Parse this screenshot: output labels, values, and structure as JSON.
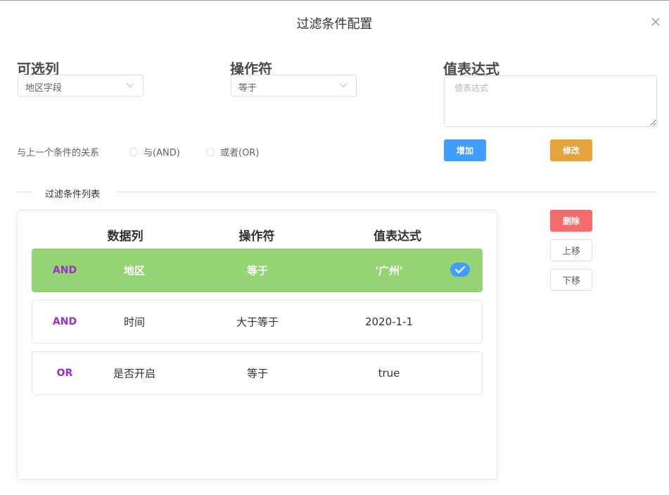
{
  "dialog": {
    "title": "过滤条件配置"
  },
  "form": {
    "column_label": "可选列",
    "column_value": "地区字段",
    "operator_label": "操作符",
    "operator_value": "等于",
    "expression_label": "值表达式",
    "expression_placeholder": "值表达式",
    "relation_label": "与上一个条件的关系",
    "relation_options": [
      "与(AND)",
      "或者(OR)"
    ],
    "add_button": "增加",
    "modify_button": "修改"
  },
  "divider": {
    "title": "过滤条件列表"
  },
  "list": {
    "headers": [
      "数据列",
      "操作符",
      "值表达式"
    ],
    "rows": [
      {
        "relation": "AND",
        "column": "地区",
        "operator": "等于",
        "value": "'广州'",
        "selected": true
      },
      {
        "relation": "AND",
        "column": "时间",
        "operator": "大于等于",
        "value": "2020-1-1",
        "selected": false
      },
      {
        "relation": "OR",
        "column": "是否开启",
        "operator": "等于",
        "value": "true",
        "selected": false
      }
    ]
  },
  "actions": {
    "delete": "删除",
    "move_up": "上移",
    "move_down": "下移"
  },
  "colors": {
    "primary": "#409eff",
    "warning": "#e6a23c",
    "danger": "#f56c6c",
    "selected_row": "#95d475",
    "relation_text": "#9b2fc6"
  },
  "icons": {
    "close": "close-icon",
    "select_arrow": "chevron-down-icon",
    "selected": "check-icon"
  }
}
